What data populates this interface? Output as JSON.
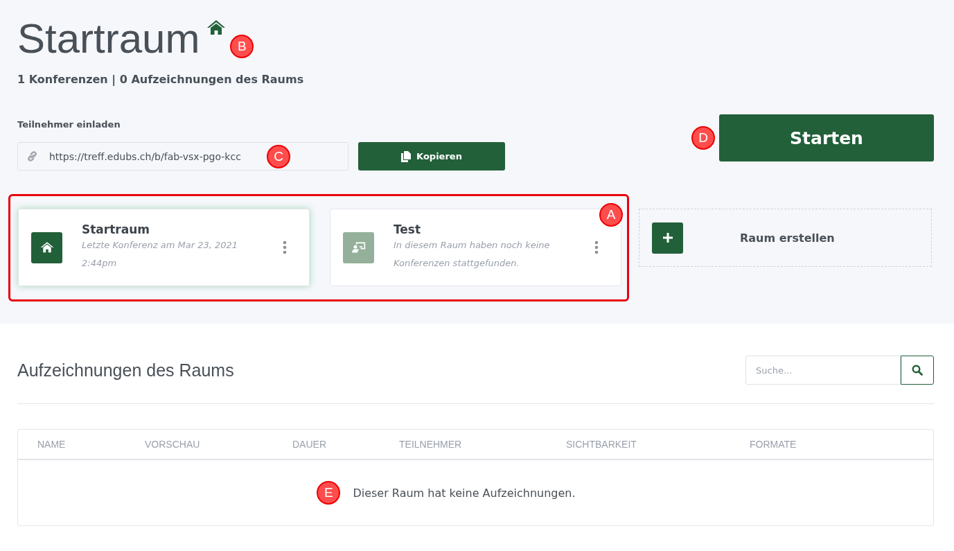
{
  "room": {
    "title": "Startraum",
    "home": true,
    "stats": "1 Konferenzen | 0 Aufzeichnungen des Raums"
  },
  "invite": {
    "label": "Teilnehmer einladen",
    "url": "https://treff.edubs.ch/b/fab-vsx-pgo-kcc",
    "copy_button": "Kopieren"
  },
  "start_button": "Starten",
  "rooms": [
    {
      "name": "Startraum",
      "subtitle": "Letzte Konferenz am Mar 23, 2021 2:44pm",
      "kind": "home",
      "selected": true
    },
    {
      "name": "Test",
      "subtitle": "In diesem Raum haben noch keine Konferenzen stattgefunden.",
      "kind": "presenter",
      "selected": false
    }
  ],
  "create_room": "Raum erstellen",
  "recordings": {
    "title": "Aufzeichnungen des Raums",
    "search": {
      "placeholder": "Suche..."
    },
    "columns": [
      "NAME",
      "VORSCHAU",
      "DAUER",
      "TEILNEHMER",
      "SICHTBARKEIT",
      "FORMATE"
    ],
    "empty": "Dieser Raum hat keine Aufzeichnungen."
  },
  "annotations": [
    "A",
    "B",
    "C",
    "D",
    "E"
  ]
}
